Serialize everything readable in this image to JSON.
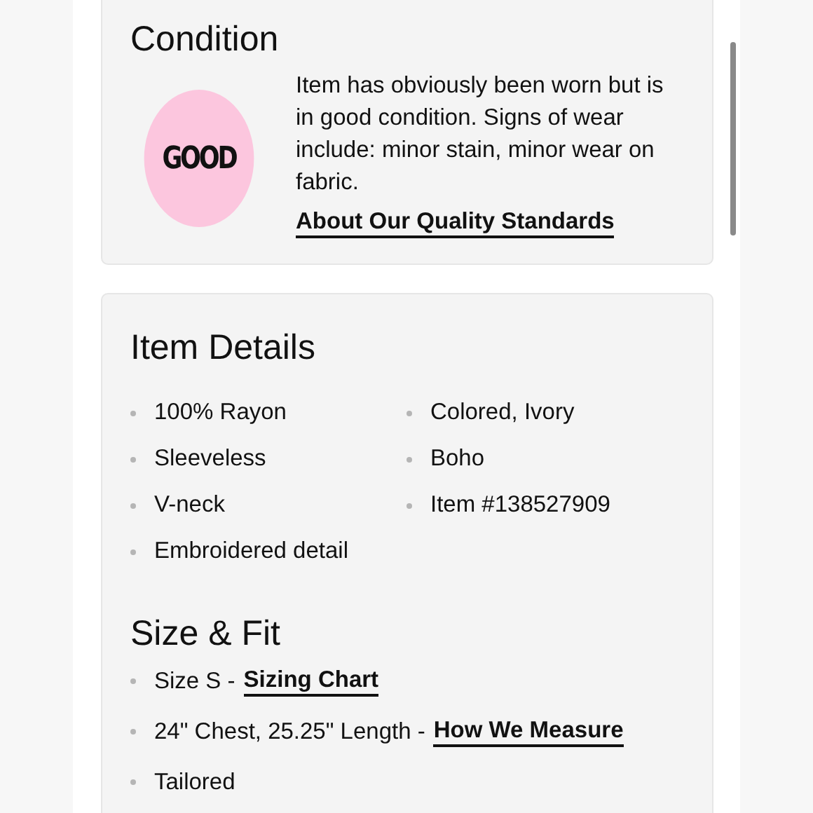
{
  "condition": {
    "title": "Condition",
    "grade": "GOOD",
    "description": "Item has obviously been worn but is in good condition. Signs of wear include: minor stain, minor wear on fabric.",
    "link": "About Our Quality Standards"
  },
  "item_details": {
    "title": "Item Details",
    "columns": [
      {
        "items": [
          "100% Rayon",
          "Sleeveless",
          "V-neck",
          "Embroidered detail"
        ]
      },
      {
        "items": [
          "Colored, Ivory",
          "Boho",
          "Item #138527909"
        ]
      }
    ]
  },
  "size_fit": {
    "title": "Size & Fit",
    "items": [
      {
        "text": "Size S -",
        "link": "Sizing Chart"
      },
      {
        "text": "24\" Chest, 25.25\" Length -",
        "link": "How We Measure"
      },
      {
        "text": "Tailored"
      }
    ]
  }
}
